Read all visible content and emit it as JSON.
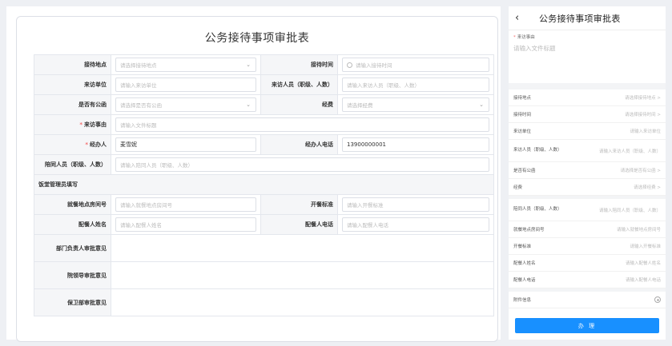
{
  "form": {
    "title": "公务接待事项审批表",
    "rows": {
      "location_label": "接待地点",
      "location_ph": "请选择接待地点",
      "time_label": "接待时间",
      "time_ph": "请输入接待时间",
      "unit_label": "来访单位",
      "unit_ph": "请输入来访单位",
      "visitor_label": "来访人员（职级、人数）",
      "visitor_ph": "请输入来访人员（职级、人数）",
      "official_label": "是否有公函",
      "official_ph": "请选择是否有公函",
      "funds_label": "经费",
      "funds_ph": "请选择经费",
      "reason_label": "来访事由",
      "reason_ph": "请输入文件标题",
      "handler_label": "经办人",
      "handler_value": "麦雪妮",
      "phone_label": "经办人电话",
      "phone_value": "13900000001",
      "accomp_label": "陪同人员（职级、人数）",
      "accomp_ph": "请输入陪同人员（职级、人数）",
      "section_label": "饭堂管理员填写",
      "dining_label": "就餐地点房间号",
      "dining_ph": "请输入就餐地点房间号",
      "standard_label": "开餐标准",
      "standard_ph": "请输入开餐标准",
      "server_label": "配餐人姓名",
      "server_ph": "请输入配餐人姓名",
      "server_phone_label": "配餐人电话",
      "server_phone_ph": "请输入配餐人电话",
      "dept_opinion_label": "部门负责人审批意见",
      "leader_opinion_label": "院领导审批意见",
      "security_opinion_label": "保卫部审批意见"
    }
  },
  "mobile": {
    "title": "公务接待事项审批表",
    "reason_label": "来访事由",
    "reason_ph": "请输入文件标题",
    "rows": [
      {
        "k": "接待地点",
        "v": "请选择接待地点 >"
      },
      {
        "k": "接待时间",
        "v": "请选择接待时间 >"
      },
      {
        "k": "来访单位",
        "v": "请输入来访单位"
      },
      {
        "k": "来访人员（职级、人数）",
        "v": "请输入来访人员（职级、人数）"
      },
      {
        "k": "是否有公函",
        "v": "请选择是否有公函 >"
      },
      {
        "k": "经费",
        "v": "请选择经费 >"
      },
      {
        "k": "陪同人员（职级、人数）",
        "v": "请输入陪同人员（职级、人数）"
      },
      {
        "k": "就餐地点房间号",
        "v": "请输入就餐地点房间号"
      },
      {
        "k": "开餐标准",
        "v": "请输入开餐标准"
      },
      {
        "k": "配餐人姓名",
        "v": "请输入配餐人姓名"
      },
      {
        "k": "配餐人电话",
        "v": "请输入配餐人电话"
      },
      {
        "k": "附件信息",
        "v": ""
      }
    ],
    "submit_label": "办 理"
  }
}
